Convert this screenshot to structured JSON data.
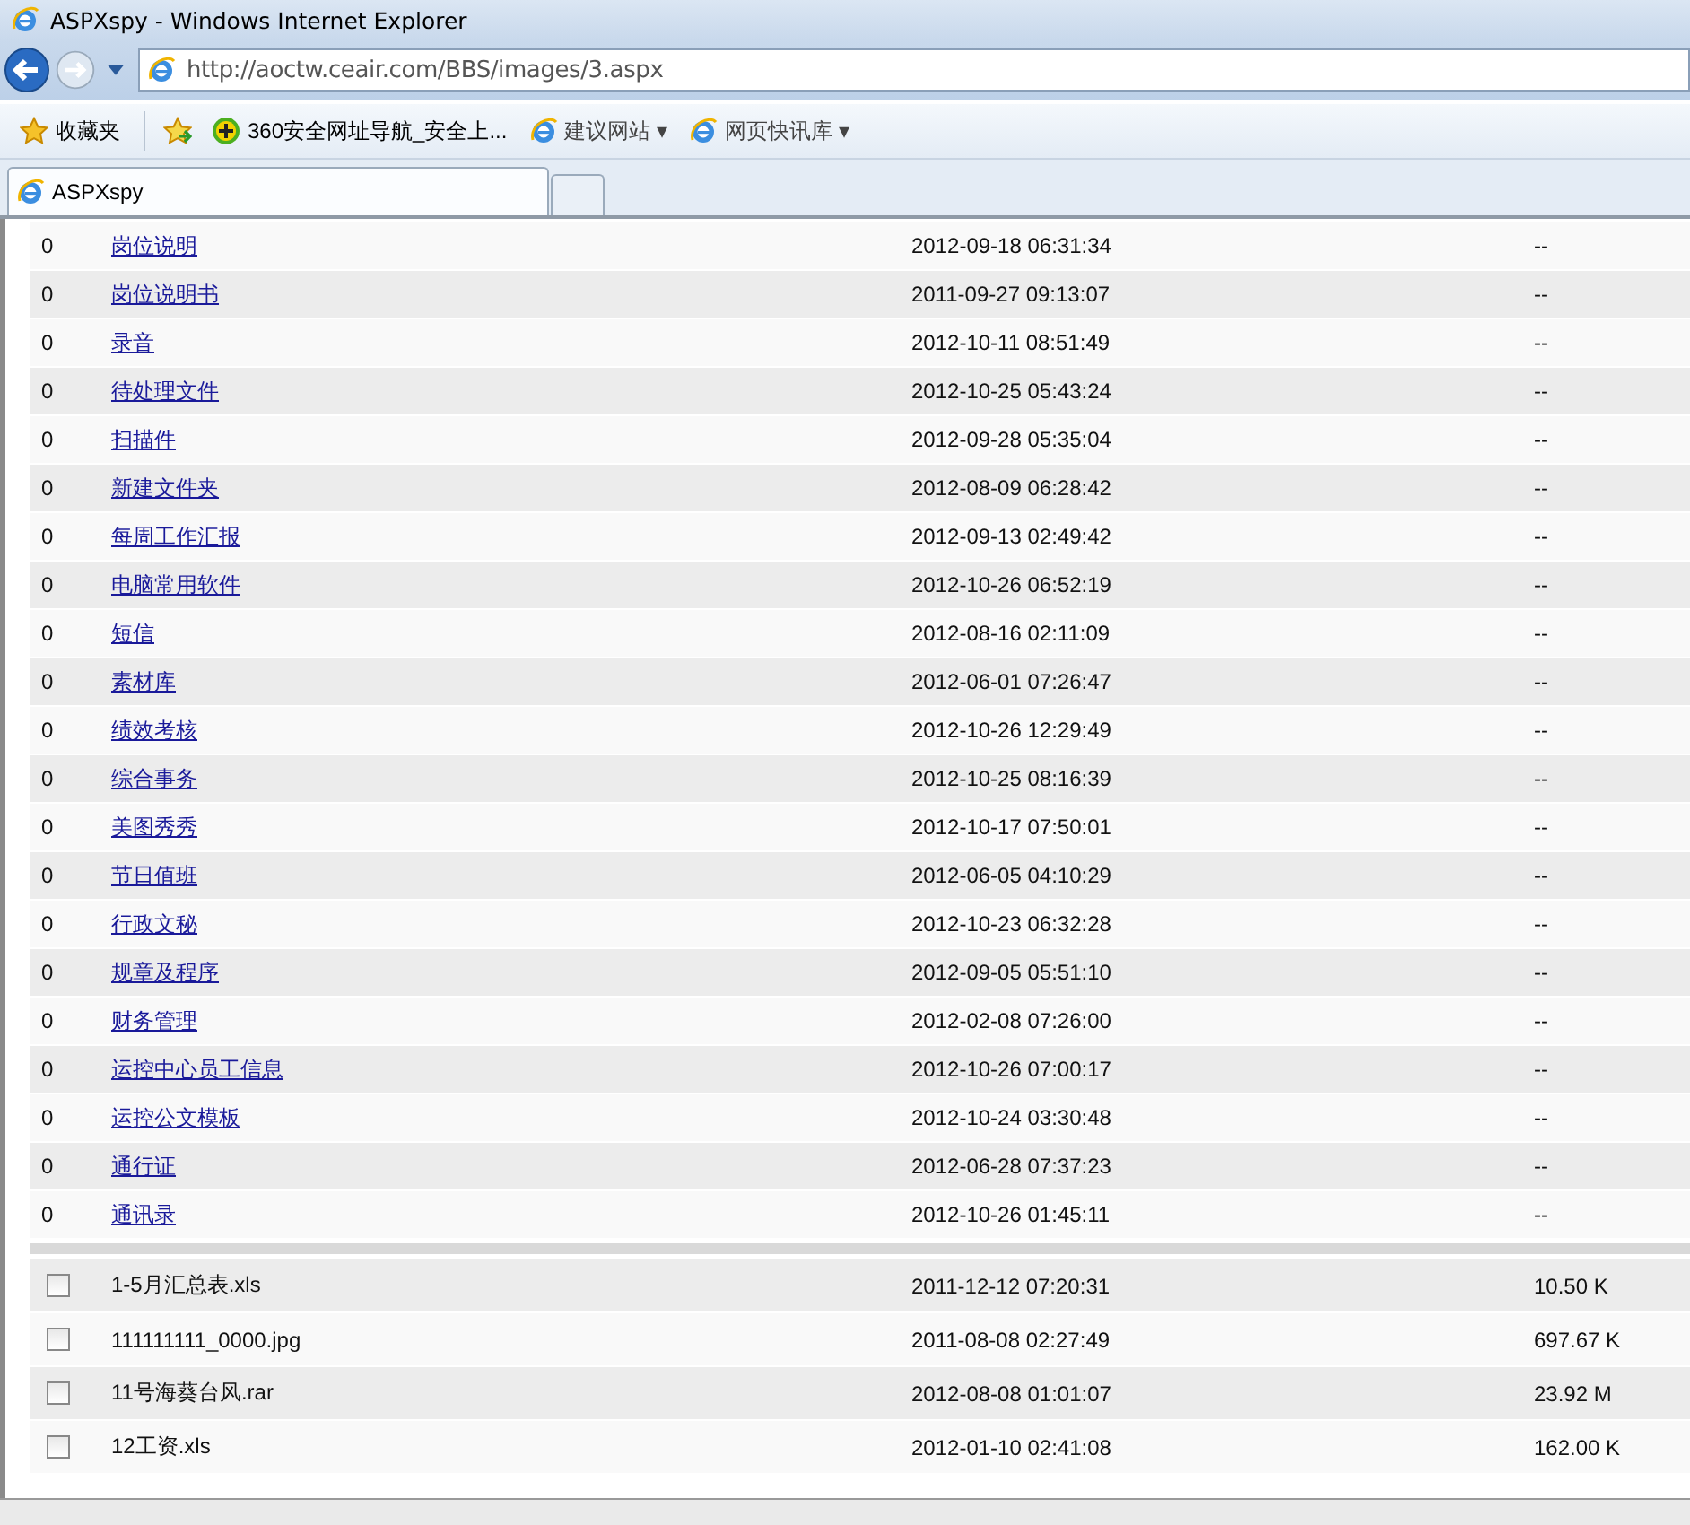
{
  "window": {
    "title": "ASPXspy - Windows Internet Explorer"
  },
  "address_bar": {
    "value": "http://aoctw.ceair.com/BBS/images/3.aspx"
  },
  "favorites_bar": [
    {
      "kind": "favorites",
      "label": "收藏夹"
    },
    {
      "kind": "site",
      "label": "360安全网址导航_安全上..."
    },
    {
      "kind": "menu",
      "label": "建议网站 ▾"
    },
    {
      "kind": "menu",
      "label": "网页快讯库 ▾"
    }
  ],
  "tabs": [
    {
      "label": "ASPXspy",
      "selected": true
    }
  ],
  "folders": [
    {
      "count": "0",
      "name": "岗位说明",
      "modified": "2012-09-18 06:31:34",
      "size": "--"
    },
    {
      "count": "0",
      "name": "岗位说明书",
      "modified": "2011-09-27 09:13:07",
      "size": "--"
    },
    {
      "count": "0",
      "name": "录音",
      "modified": "2012-10-11 08:51:49",
      "size": "--"
    },
    {
      "count": "0",
      "name": "待处理文件",
      "modified": "2012-10-25 05:43:24",
      "size": "--"
    },
    {
      "count": "0",
      "name": "扫描件",
      "modified": "2012-09-28 05:35:04",
      "size": "--"
    },
    {
      "count": "0",
      "name": "新建文件夹",
      "modified": "2012-08-09 06:28:42",
      "size": "--"
    },
    {
      "count": "0",
      "name": "每周工作汇报",
      "modified": "2012-09-13 02:49:42",
      "size": "--"
    },
    {
      "count": "0",
      "name": "电脑常用软件",
      "modified": "2012-10-26 06:52:19",
      "size": "--"
    },
    {
      "count": "0",
      "name": "短信",
      "modified": "2012-08-16 02:11:09",
      "size": "--"
    },
    {
      "count": "0",
      "name": "素材库",
      "modified": "2012-06-01 07:26:47",
      "size": "--"
    },
    {
      "count": "0",
      "name": "绩效考核",
      "modified": "2012-10-26 12:29:49",
      "size": "--"
    },
    {
      "count": "0",
      "name": "综合事务",
      "modified": "2012-10-25 08:16:39",
      "size": "--"
    },
    {
      "count": "0",
      "name": "美图秀秀",
      "modified": "2012-10-17 07:50:01",
      "size": "--"
    },
    {
      "count": "0",
      "name": "节日值班",
      "modified": "2012-06-05 04:10:29",
      "size": "--"
    },
    {
      "count": "0",
      "name": "行政文秘",
      "modified": "2012-10-23 06:32:28",
      "size": "--"
    },
    {
      "count": "0",
      "name": "规章及程序",
      "modified": "2012-09-05 05:51:10",
      "size": "--"
    },
    {
      "count": "0",
      "name": "财务管理",
      "modified": "2012-02-08 07:26:00",
      "size": "--"
    },
    {
      "count": "0",
      "name": "运控中心员工信息",
      "modified": "2012-10-26 07:00:17",
      "size": "--"
    },
    {
      "count": "0",
      "name": "运控公文模板",
      "modified": "2012-10-24 03:30:48",
      "size": "--"
    },
    {
      "count": "0",
      "name": "通行证",
      "modified": "2012-06-28 07:37:23",
      "size": "--"
    },
    {
      "count": "0",
      "name": "通讯录",
      "modified": "2012-10-26 01:45:11",
      "size": "--"
    }
  ],
  "files": [
    {
      "checked": false,
      "name": "1-5月汇总表.xls",
      "modified": "2011-12-12 07:20:31",
      "size": "10.50 K"
    },
    {
      "checked": false,
      "name": "111111111_0000.jpg",
      "modified": "2011-08-08 02:27:49",
      "size": "697.67 K"
    },
    {
      "checked": false,
      "name": "11号海葵台风.rar",
      "modified": "2012-08-08 01:01:07",
      "size": "23.92 M"
    },
    {
      "checked": false,
      "name": "12工资.xls",
      "modified": "2012-01-10 02:41:08",
      "size": "162.00 K"
    }
  ]
}
